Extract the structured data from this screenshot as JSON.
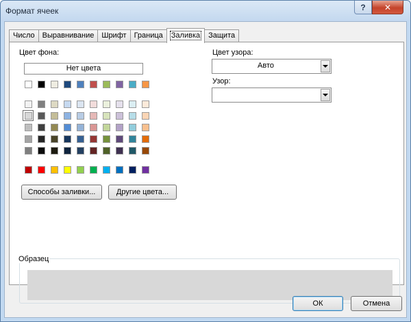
{
  "window": {
    "title": "Формат ячеек",
    "help_label": "?",
    "close_label": "✕"
  },
  "tabs": [
    {
      "label": "Число"
    },
    {
      "label": "Выравнивание"
    },
    {
      "label": "Шрифт"
    },
    {
      "label": "Граница"
    },
    {
      "label": "Заливка",
      "active": true
    },
    {
      "label": "Защита"
    }
  ],
  "fill": {
    "bg_color_label": "Цвет фона:",
    "no_color_label": "Нет цвета",
    "fill_effects_label": "Способы заливки...",
    "more_colors_label": "Другие цвета...",
    "pattern_color_label": "Цвет узора:",
    "pattern_color_value": "Авто",
    "pattern_style_label": "Узор:",
    "pattern_style_value": "",
    "sample_label": "Образец",
    "sample_color": "#d8d8d8"
  },
  "palette": {
    "theme_row": [
      "#ffffff",
      "#000000",
      "#eeece1",
      "#1f497d",
      "#4f81bd",
      "#c0504d",
      "#9bbb59",
      "#8064a2",
      "#4bacc6",
      "#f79646"
    ],
    "tint_rows": [
      [
        "#f2f2f2",
        "#7f7f7f",
        "#ddd9c3",
        "#c6d9f0",
        "#dbe5f1",
        "#f2dcdb",
        "#ebf1dd",
        "#e5e0ec",
        "#dbeef3",
        "#fdeada"
      ],
      [
        "#d8d8d8",
        "#595959",
        "#c4bd97",
        "#8db3e2",
        "#b8cce4",
        "#e5b9b7",
        "#d7e3bc",
        "#ccc1d9",
        "#b7dde8",
        "#fbd5b5"
      ],
      [
        "#bfbfbf",
        "#3f3f3f",
        "#938953",
        "#548dd4",
        "#95b3d7",
        "#d99694",
        "#c3d69b",
        "#b2a2c7",
        "#92cddc",
        "#fac08f"
      ],
      [
        "#a5a5a5",
        "#262626",
        "#494429",
        "#17365d",
        "#366092",
        "#953734",
        "#76923c",
        "#5f497a",
        "#31859b",
        "#e36c09"
      ],
      [
        "#7f7f7f",
        "#0c0c0c",
        "#1d1b10",
        "#0f243e",
        "#244061",
        "#632423",
        "#4f6128",
        "#3f3151",
        "#205867",
        "#974806"
      ]
    ],
    "standard_row": [
      "#c00000",
      "#ff0000",
      "#ffc000",
      "#ffff00",
      "#92d050",
      "#00b050",
      "#00b0f0",
      "#0070c0",
      "#002060",
      "#7030a0"
    ],
    "selected": "#d8d8d8"
  },
  "footer": {
    "ok_label": "ОК",
    "cancel_label": "Отмена"
  }
}
